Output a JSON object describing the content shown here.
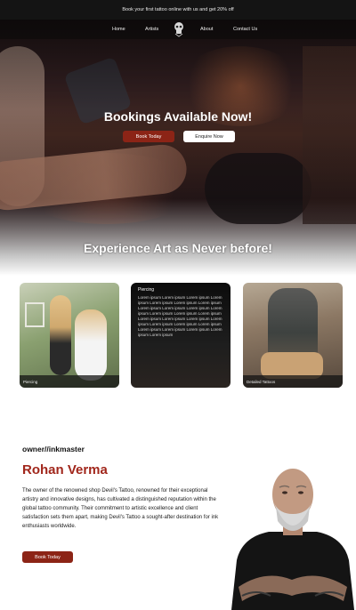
{
  "promo_bar": {
    "text": "Book your first tattoo online with us and get 20% off"
  },
  "nav": {
    "items": [
      {
        "label": "Home"
      },
      {
        "label": "Artists"
      },
      {
        "label": "About"
      },
      {
        "label": "Contact Us"
      }
    ],
    "logo_icon": "skull-logo-icon"
  },
  "hero": {
    "title": "Bookings Available Now!",
    "primary_button": "Book Today",
    "secondary_button": "Enquire Now"
  },
  "experience": {
    "title": "Experience Art  as Never before!",
    "cards": [
      {
        "label": "Piercing"
      },
      {
        "title": "Piercing",
        "body": "Lorem ipsum Lorem ipsum Lorem ipsum Lorem ipsum Lorem ipsum Lorem ipsum Lorem ipsum Lorem ipsum Lorem ipsum Lorem ipsum Lorem ipsum Lorem ipsum Lorem ipsum Lorem ipsum Lorem ipsum Lorem ipsum Lorem ipsum Lorem ipsum Lorem ipsum Lorem ipsum Lorem ipsum Lorem ipsum Lorem ipsum Lorem ipsum Lorem ipsum Lorem ipsum"
      },
      {
        "label": "Detailed Tattoos"
      }
    ]
  },
  "owner": {
    "tag": "owner//inkmaster",
    "name": "Rohan Verma",
    "bio": "The owner of the renowned shop Devil's Tattoo, renowned for their exceptional artistry and innovative designs, has cultivated a distinguished reputation within the global tattoo community. Their commitment to artistic excellence and client satisfaction sets them apart, making Devil's Tattoo a sought-after destination for ink enthusiasts worldwide.",
    "button": "Book Today"
  },
  "colors": {
    "accent": "#8c2416",
    "name_red": "#a1271c",
    "dark": "#141414"
  }
}
